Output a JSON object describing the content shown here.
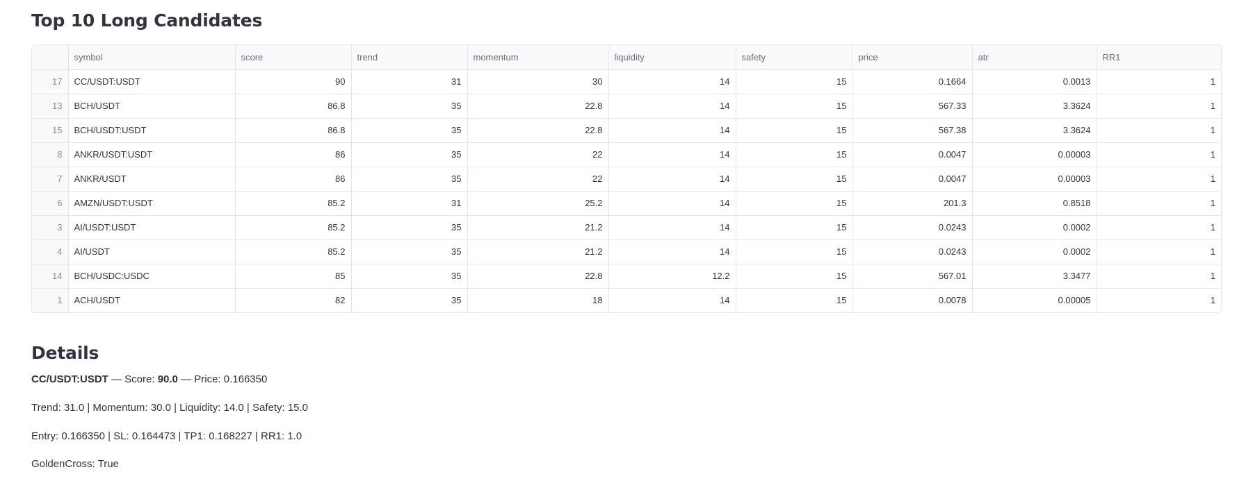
{
  "top": {
    "title": "Top 10 Long Candidates"
  },
  "table": {
    "columns": [
      "",
      "symbol",
      "score",
      "trend",
      "momentum",
      "liquidity",
      "safety",
      "price",
      "atr",
      "RR1"
    ],
    "rows": [
      {
        "index": "17",
        "symbol": "CC/USDT:USDT",
        "score": "90",
        "trend": "31",
        "momentum": "30",
        "liquidity": "14",
        "safety": "15",
        "price": "0.1664",
        "atr": "0.0013",
        "rr1": "1"
      },
      {
        "index": "13",
        "symbol": "BCH/USDT",
        "score": "86.8",
        "trend": "35",
        "momentum": "22.8",
        "liquidity": "14",
        "safety": "15",
        "price": "567.33",
        "atr": "3.3624",
        "rr1": "1"
      },
      {
        "index": "15",
        "symbol": "BCH/USDT:USDT",
        "score": "86.8",
        "trend": "35",
        "momentum": "22.8",
        "liquidity": "14",
        "safety": "15",
        "price": "567.38",
        "atr": "3.3624",
        "rr1": "1"
      },
      {
        "index": "8",
        "symbol": "ANKR/USDT:USDT",
        "score": "86",
        "trend": "35",
        "momentum": "22",
        "liquidity": "14",
        "safety": "15",
        "price": "0.0047",
        "atr": "0.00003",
        "rr1": "1"
      },
      {
        "index": "7",
        "symbol": "ANKR/USDT",
        "score": "86",
        "trend": "35",
        "momentum": "22",
        "liquidity": "14",
        "safety": "15",
        "price": "0.0047",
        "atr": "0.00003",
        "rr1": "1"
      },
      {
        "index": "6",
        "symbol": "AMZN/USDT:USDT",
        "score": "85.2",
        "trend": "31",
        "momentum": "25.2",
        "liquidity": "14",
        "safety": "15",
        "price": "201.3",
        "atr": "0.8518",
        "rr1": "1"
      },
      {
        "index": "3",
        "symbol": "AI/USDT:USDT",
        "score": "85.2",
        "trend": "35",
        "momentum": "21.2",
        "liquidity": "14",
        "safety": "15",
        "price": "0.0243",
        "atr": "0.0002",
        "rr1": "1"
      },
      {
        "index": "4",
        "symbol": "AI/USDT",
        "score": "85.2",
        "trend": "35",
        "momentum": "21.2",
        "liquidity": "14",
        "safety": "15",
        "price": "0.0243",
        "atr": "0.0002",
        "rr1": "1"
      },
      {
        "index": "14",
        "symbol": "BCH/USDC:USDC",
        "score": "85",
        "trend": "35",
        "momentum": "22.8",
        "liquidity": "12.2",
        "safety": "15",
        "price": "567.01",
        "atr": "3.3477",
        "rr1": "1"
      },
      {
        "index": "1",
        "symbol": "ACH/USDT",
        "score": "82",
        "trend": "35",
        "momentum": "18",
        "liquidity": "14",
        "safety": "15",
        "price": "0.0078",
        "atr": "0.00005",
        "rr1": "1"
      }
    ]
  },
  "details": {
    "title": "Details",
    "symbol": "CC/USDT:USDT",
    "dash1": " — Score: ",
    "score": "90.0",
    "dash2": " — Price: 0.166350",
    "line2": "Trend: 31.0 | Momentum: 30.0 | Liquidity: 14.0 | Safety: 15.0",
    "line3": "Entry: 0.166350 | SL: 0.164473 | TP1: 0.168227 | RR1: 1.0",
    "line4": "GoldenCross: True"
  }
}
